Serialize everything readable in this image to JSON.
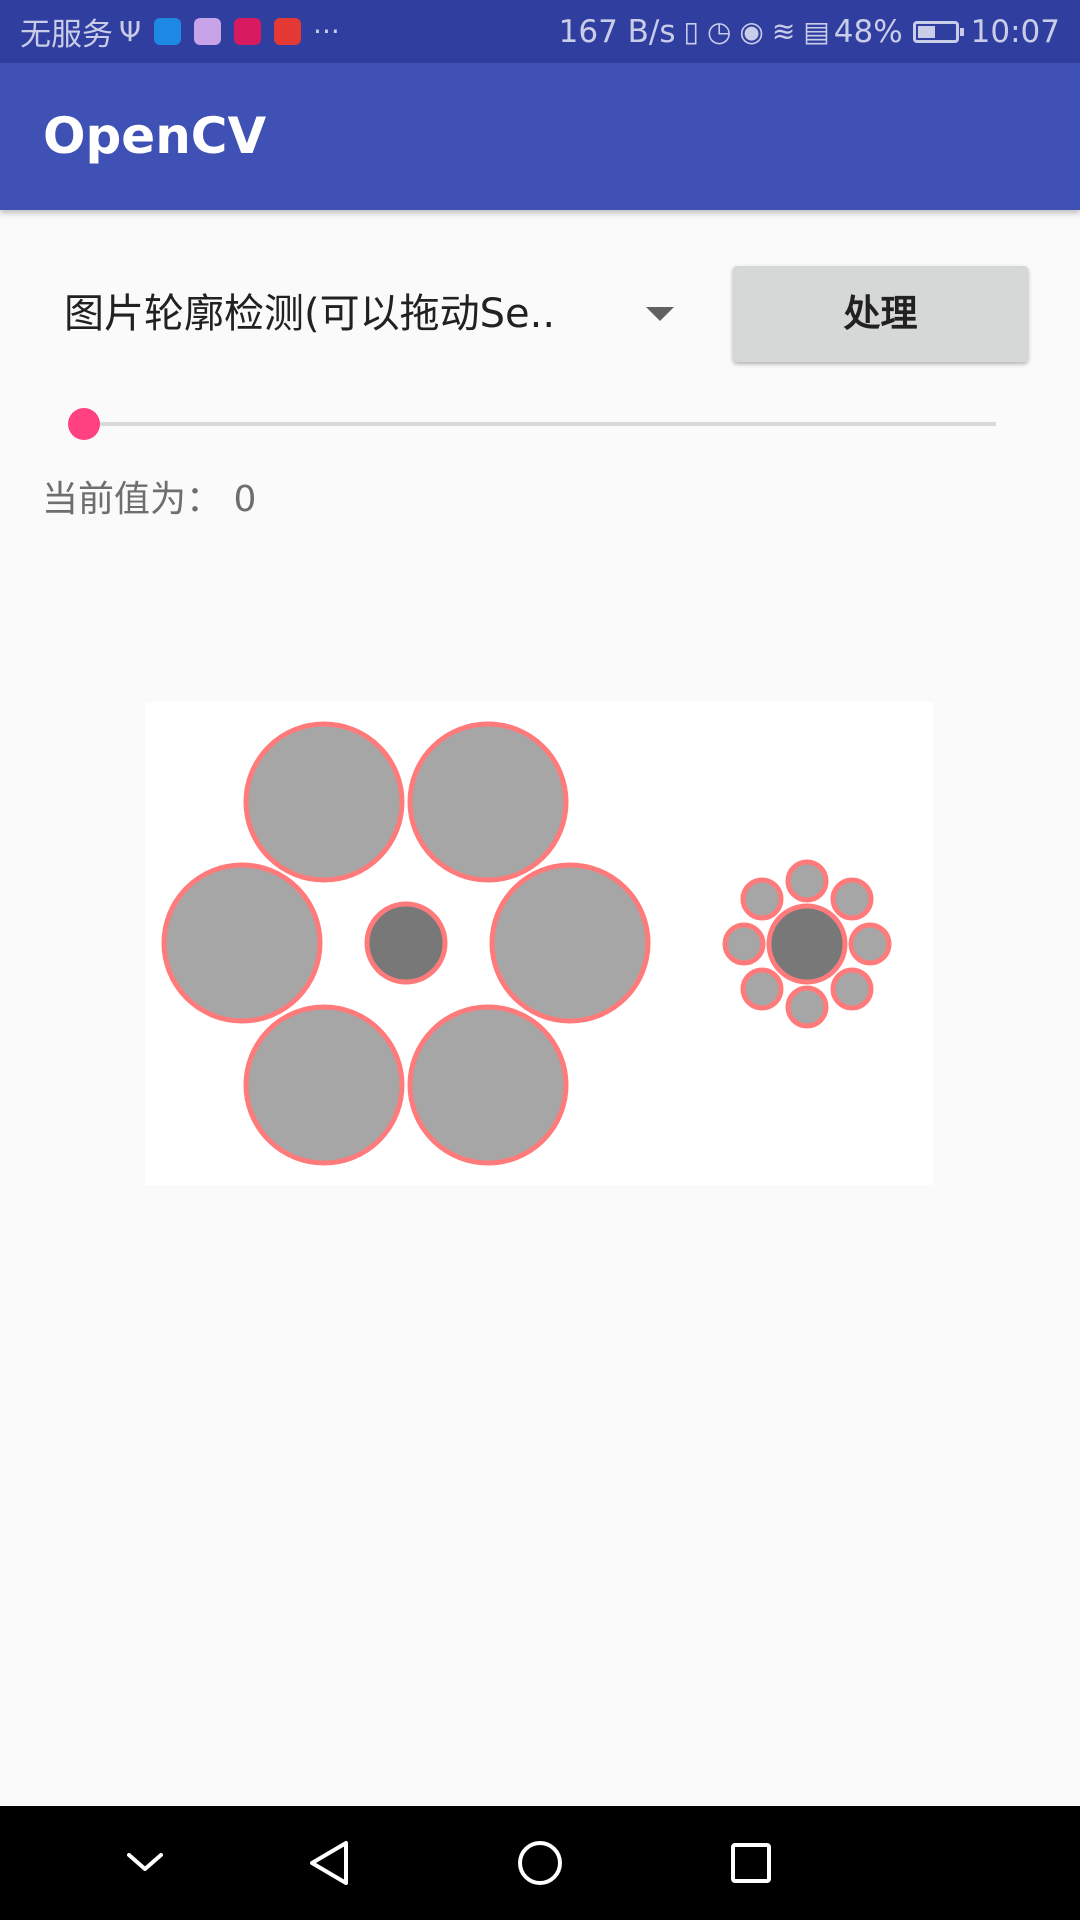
{
  "status_bar": {
    "carrier": "无服务",
    "usb_icon": "usb-icon",
    "app_icons": [
      {
        "name": "browser-app-icon",
        "color": "#1e88e5"
      },
      {
        "name": "photos-app-icon",
        "color": "#c9a3e8"
      },
      {
        "name": "huawei-app-icon",
        "color": "#d81b60"
      },
      {
        "name": "video-app-icon",
        "color": "#e53935"
      }
    ],
    "more": "···",
    "net_speed": "167 B/s",
    "battery_percent": "48%",
    "battery_level": 0.48,
    "time": "10:07",
    "background": "#303f9f"
  },
  "app_bar": {
    "title": "OpenCV",
    "background": "#3f51b5"
  },
  "spinner": {
    "selected": "图片轮廓检测(可以拖动Se.."
  },
  "process_button": {
    "label": "处理"
  },
  "seekbar": {
    "value": 0,
    "accent": "#ff4081"
  },
  "value_label": {
    "text": "当前值为： 0"
  },
  "result_image": {
    "description_colors": {
      "fill_large": "#a6a6a6",
      "fill_center": "#787878",
      "contour": "#ff7b7b"
    }
  },
  "nav_bar": {
    "buttons": [
      "chevron-down-icon",
      "back-icon",
      "home-icon",
      "recents-icon"
    ]
  }
}
